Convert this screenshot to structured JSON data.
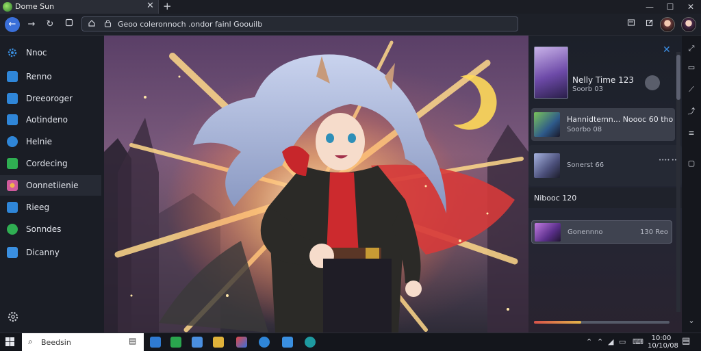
{
  "window": {
    "tab_title": "Dome Sun",
    "tab_close": "✕",
    "new_tab": "+",
    "minimize": "—",
    "maximize": "☐",
    "close": "✕"
  },
  "navbar": {
    "back": "←",
    "forward": "→",
    "refresh": "↻",
    "url": "Geoo coleronnoch .ondor fainl Goouilb"
  },
  "sidebar": {
    "items": [
      {
        "label": "Nnoc",
        "icon": "gear-icon",
        "color": "#3a8fe0"
      },
      {
        "label": "Renno",
        "icon": "home-icon",
        "color": "#2f86d8"
      },
      {
        "label": "Dreeoroger",
        "icon": "window-icon",
        "color": "#2f86d8"
      },
      {
        "label": "Aotindeno",
        "icon": "document-icon",
        "color": "#2f86d8"
      },
      {
        "label": "Helnie",
        "icon": "globe-icon",
        "color": "#2f86d8"
      },
      {
        "label": "Cordecing",
        "icon": "folder-icon",
        "color": "#2fae52"
      },
      {
        "label": "Oonnetiienie",
        "icon": "flower-icon",
        "color": "#d05a9c"
      },
      {
        "label": "Rieeg",
        "icon": "message-icon",
        "color": "#2f86d8"
      },
      {
        "label": "Sonndes",
        "icon": "chat-icon",
        "color": "#2fae52"
      },
      {
        "label": "Dicanny",
        "icon": "chart-icon",
        "color": "#3a8fe0"
      }
    ]
  },
  "panel": {
    "featured_title": "Nelly Time 123",
    "featured_sub": "Soorb 03",
    "card1_title": "Hannidtemn... Noooc 60 tho",
    "card1_sub": "Soorbo 08",
    "card2_sub": "Sonerst 66",
    "card2_tag": "•••• ••",
    "section_label": "Nibooc 120",
    "card3_title": "Gonennno",
    "card3_right": "130 Reo",
    "progress": 0.35
  },
  "taskbar": {
    "search_placeholder": "Beedsin",
    "time": "10:00",
    "date": "10/10/08"
  }
}
